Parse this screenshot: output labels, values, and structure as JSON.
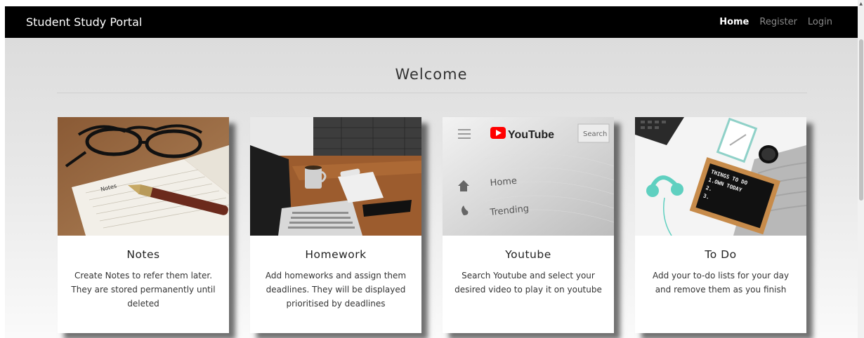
{
  "navbar": {
    "brand": "Student Study Portal",
    "links": [
      {
        "label": "Home",
        "active": true
      },
      {
        "label": "Register",
        "active": false
      },
      {
        "label": "Login",
        "active": false
      }
    ]
  },
  "main": {
    "title": "Welcome",
    "cards": [
      {
        "title": "Notes",
        "text": "Create Notes to refer them later. They are stored permanently until deleted",
        "image": "notebook-glasses-pen-photo"
      },
      {
        "title": "Homework",
        "text": "Add homeworks and assign them deadlines. They will be displayed prioritised by deadlines",
        "image": "laptop-desk-coffee-photo"
      },
      {
        "title": "Youtube",
        "text": "Search Youtube and select your desired video to play it on youtube",
        "image": "youtube-screen-photo",
        "image_text": {
          "logo": "YouTube",
          "search": "Search",
          "home": "Home",
          "trending": "Trending"
        }
      },
      {
        "title": "To Do",
        "text": "Add your to-do lists for your day and remove them as you finish",
        "image": "todo-chalkboard-photo",
        "image_text": {
          "board": [
            "THINGS TO DO",
            "1.OWN TODAY",
            "2.",
            "3."
          ]
        }
      }
    ]
  },
  "colors": {
    "navbar_bg": "#000000",
    "nav_active": "#ffffff",
    "nav_inactive": "#8a8a8a",
    "youtube_red": "#ff0000"
  }
}
